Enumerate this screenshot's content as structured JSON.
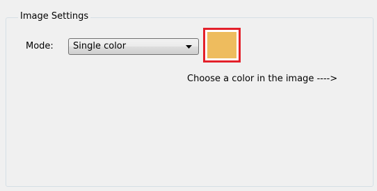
{
  "image_settings": {
    "title": "Image Settings",
    "mode_label": "Mode:",
    "mode": {
      "selected": "Single color"
    },
    "color_swatch": {
      "color": "#eebc5e",
      "highlight_color": "#e3202a"
    },
    "hint_text": "Choose a color in the image ---->"
  }
}
